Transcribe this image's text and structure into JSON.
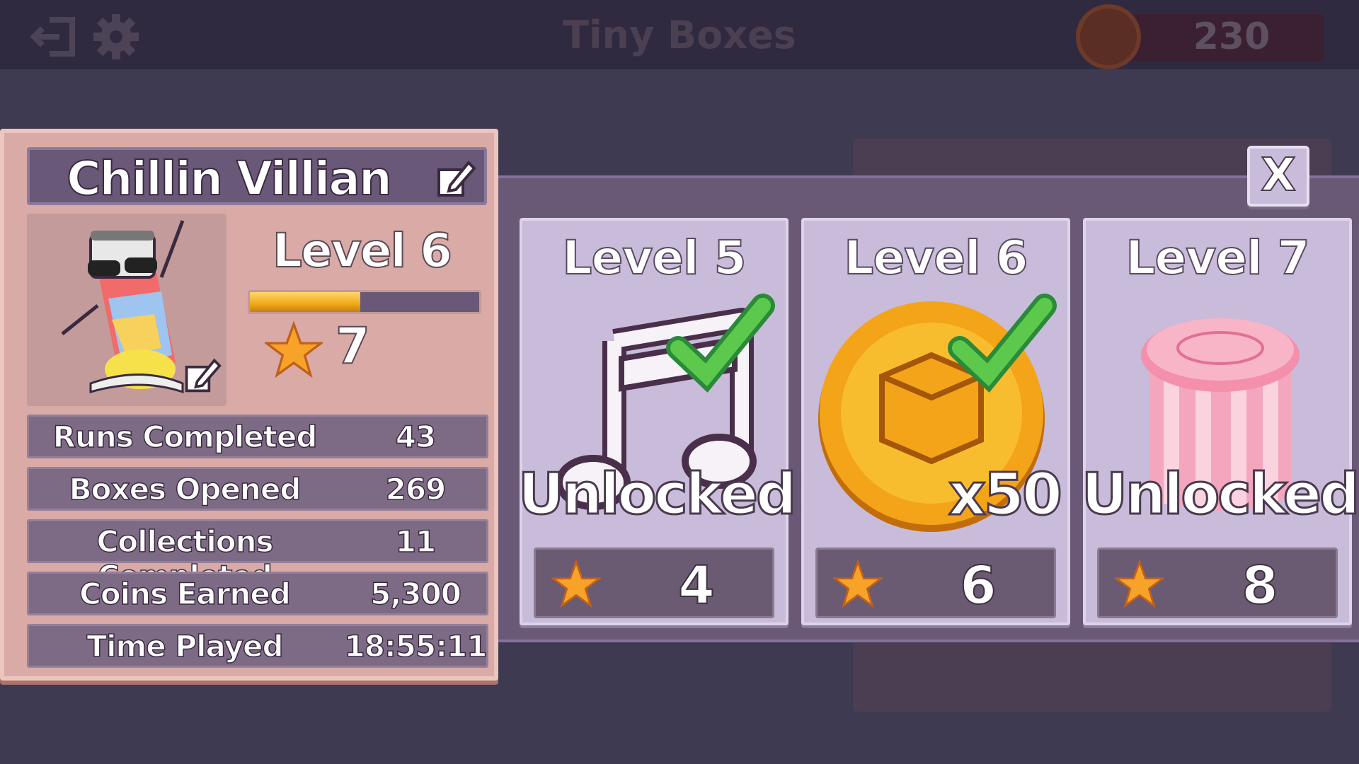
{
  "header": {
    "title": "Tiny Boxes",
    "coins": "230",
    "icons": [
      "exit-icon",
      "gear-icon",
      "coin-icon"
    ]
  },
  "profile": {
    "name": "Chillin Villian",
    "level_label": "Level 6",
    "xp_progress": 0.48,
    "stars": "7",
    "icons": [
      "edit-name-icon",
      "edit-avatar-icon",
      "star-icon"
    ],
    "stats": [
      {
        "label": "Runs Completed",
        "value": "43"
      },
      {
        "label": "Boxes Opened",
        "value": "269"
      },
      {
        "label": "Collections Completed",
        "value": "11"
      },
      {
        "label": "Coins Earned",
        "value": "5,300"
      },
      {
        "label": "Time Played",
        "value": "18:55:11"
      }
    ]
  },
  "rewards": {
    "close_label": "X",
    "cards": [
      {
        "level": "Level 5",
        "caption": "Unlocked!",
        "stars": "4",
        "item": "music-note-icon",
        "claimed": true
      },
      {
        "level": "Level 6",
        "caption": "x50",
        "stars": "6",
        "item": "coin-icon",
        "claimed": true
      },
      {
        "level": "Level 7",
        "caption": "Unlocked!",
        "stars": "8",
        "item": "gift-box-icon",
        "claimed": false
      }
    ]
  },
  "colors": {
    "panel": "#d9aaa6",
    "card": "#c9bcda",
    "strip": "#6a5877",
    "xp": "#f0a818",
    "check": "#5cc94d"
  }
}
